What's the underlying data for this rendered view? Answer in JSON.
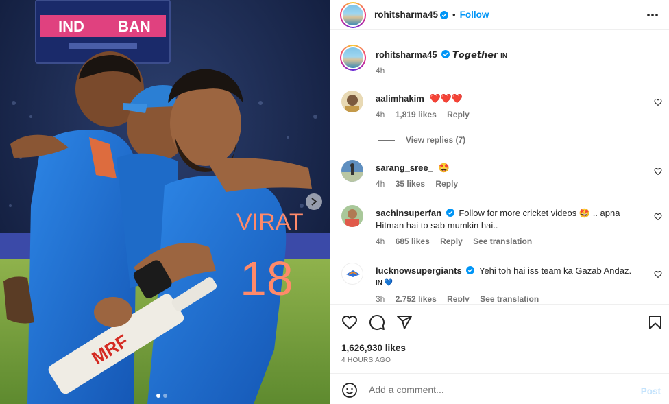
{
  "post": {
    "author": "rohitsharma45",
    "follow_label": "Follow",
    "separator": "•",
    "photo": {
      "scoreboard_left": "IND",
      "scoreboard_right": "BAN",
      "jersey_name": "VIRAT",
      "jersey_number": "18",
      "bat_brand": "MRF"
    }
  },
  "caption": {
    "author": "rohitsharma45",
    "text": "𝙏𝙤𝙜𝙚𝙩𝙝𝙚𝙧",
    "flag": "IN",
    "time": "4h"
  },
  "comments": [
    {
      "user": "aalimhakim",
      "verified": false,
      "text": "❤️❤️❤️",
      "time": "4h",
      "likes": "1,819 likes",
      "reply": "Reply",
      "translate": ""
    },
    {
      "user": "sarang_sree_",
      "verified": false,
      "text": "🤩",
      "time": "4h",
      "likes": "35 likes",
      "reply": "Reply",
      "translate": ""
    },
    {
      "user": "sachinsuperfan",
      "verified": true,
      "text": "Follow for more cricket videos 🤩 .. apna Hitman hai to sab mumkin hai..",
      "time": "4h",
      "likes": "685 likes",
      "reply": "Reply",
      "translate": "See translation"
    },
    {
      "user": "lucknowsupergiants",
      "verified": true,
      "text": "Yehi toh hai iss team ka Gazab Andaz.",
      "text2": "IN 💙",
      "time": "3h",
      "likes": "2,752 likes",
      "reply": "Reply",
      "translate": "See translation"
    }
  ],
  "view_replies": "View replies (7)",
  "likes_count": "1,626,930 likes",
  "time_ago": "4 HOURS AGO",
  "add_comment": {
    "placeholder": "Add a comment...",
    "post_label": "Post"
  },
  "icons": [
    "more-icon",
    "verified-icon",
    "heart-icon",
    "comment-icon",
    "share-icon",
    "save-icon",
    "emoji-icon",
    "chevron-right-icon"
  ],
  "colors": {
    "accent": "#0095f6",
    "heart": "#ed4956",
    "muted": "#737373",
    "jersey": "#1f6fd6",
    "post_disabled": "#c4e3fc"
  }
}
